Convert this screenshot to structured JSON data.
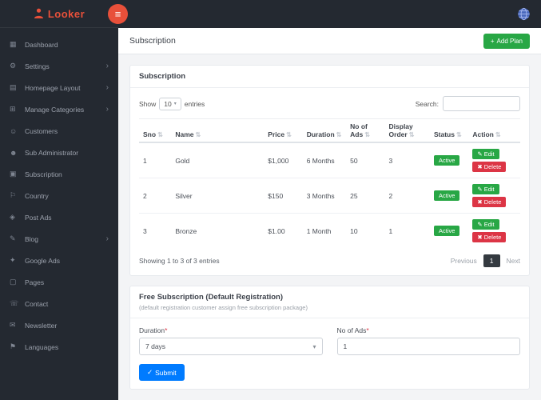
{
  "colors": {
    "brand": "#e8503a",
    "sidebar_bg": "#242931",
    "success": "#28a745",
    "danger": "#dc3545",
    "primary": "#007bff",
    "pagination_active": "#343a40"
  },
  "brand": {
    "name": "Looker"
  },
  "topbar": {
    "menu_icon": "≡"
  },
  "sidebar": {
    "chevron": "›",
    "items": [
      {
        "label": "Dashboard",
        "icon": "▦"
      },
      {
        "label": "Settings",
        "icon": "⚙"
      },
      {
        "label": "Homepage Layout",
        "icon": "▤"
      },
      {
        "label": "Manage Categories",
        "icon": "⊞"
      },
      {
        "label": "Customers",
        "icon": "☺"
      },
      {
        "label": "Sub Administrator",
        "icon": "☻"
      },
      {
        "label": "Subscription",
        "icon": "▣"
      },
      {
        "label": "Country",
        "icon": "⚐"
      },
      {
        "label": "Post Ads",
        "icon": "◈"
      },
      {
        "label": "Blog",
        "icon": "✎"
      },
      {
        "label": "Google Ads",
        "icon": "✦"
      },
      {
        "label": "Pages",
        "icon": "▢"
      },
      {
        "label": "Contact",
        "icon": "☏"
      },
      {
        "label": "Newsletter",
        "icon": "✉"
      },
      {
        "label": "Languages",
        "icon": "⚑"
      }
    ]
  },
  "breadcrumb": {
    "title": "Subscription"
  },
  "actions": {
    "add_icon": "+",
    "add_plan": "Add Plan",
    "edit_icon": "✎",
    "edit_label": "Edit",
    "delete_icon": "✖",
    "delete_label": "Delete"
  },
  "panel": {
    "title": "Subscription"
  },
  "controls": {
    "show": "Show",
    "page_size": "10",
    "entries": "entries",
    "select_arrow": "▾",
    "search": "Search:"
  },
  "table": {
    "sort_icon": "⇅",
    "headers": [
      "Sno",
      "Name",
      "Price",
      "Duration",
      "No of Ads",
      "Display Order",
      "Status",
      "Action"
    ],
    "rows": [
      {
        "sno": "1",
        "name": "Gold",
        "price": "$1,000",
        "duration": "6 Months",
        "no_of_ads": "50",
        "display_order": "3",
        "status": "Active"
      },
      {
        "sno": "2",
        "name": "Silver",
        "price": "$150",
        "duration": "3 Months",
        "no_of_ads": "25",
        "display_order": "2",
        "status": "Active"
      },
      {
        "sno": "3",
        "name": "Bronze",
        "price": "$1.00",
        "duration": "1 Month",
        "no_of_ads": "10",
        "display_order": "1",
        "status": "Active"
      }
    ]
  },
  "pagination": {
    "info": "Showing 1 to 3 of 3 entries",
    "previous": "Previous",
    "page": "1",
    "next": "Next"
  },
  "free_subscription": {
    "title": "Free Subscription (Default Registration)",
    "subtitle": "(default registration customer assign free subscription package)",
    "duration_label": "Duration",
    "required_mark": "*",
    "duration_value": "7 days",
    "select_arrow": "▾",
    "ads_label": "No of Ads",
    "ads_value": "1",
    "submit_icon": "✓",
    "submit_label": "Submit"
  }
}
